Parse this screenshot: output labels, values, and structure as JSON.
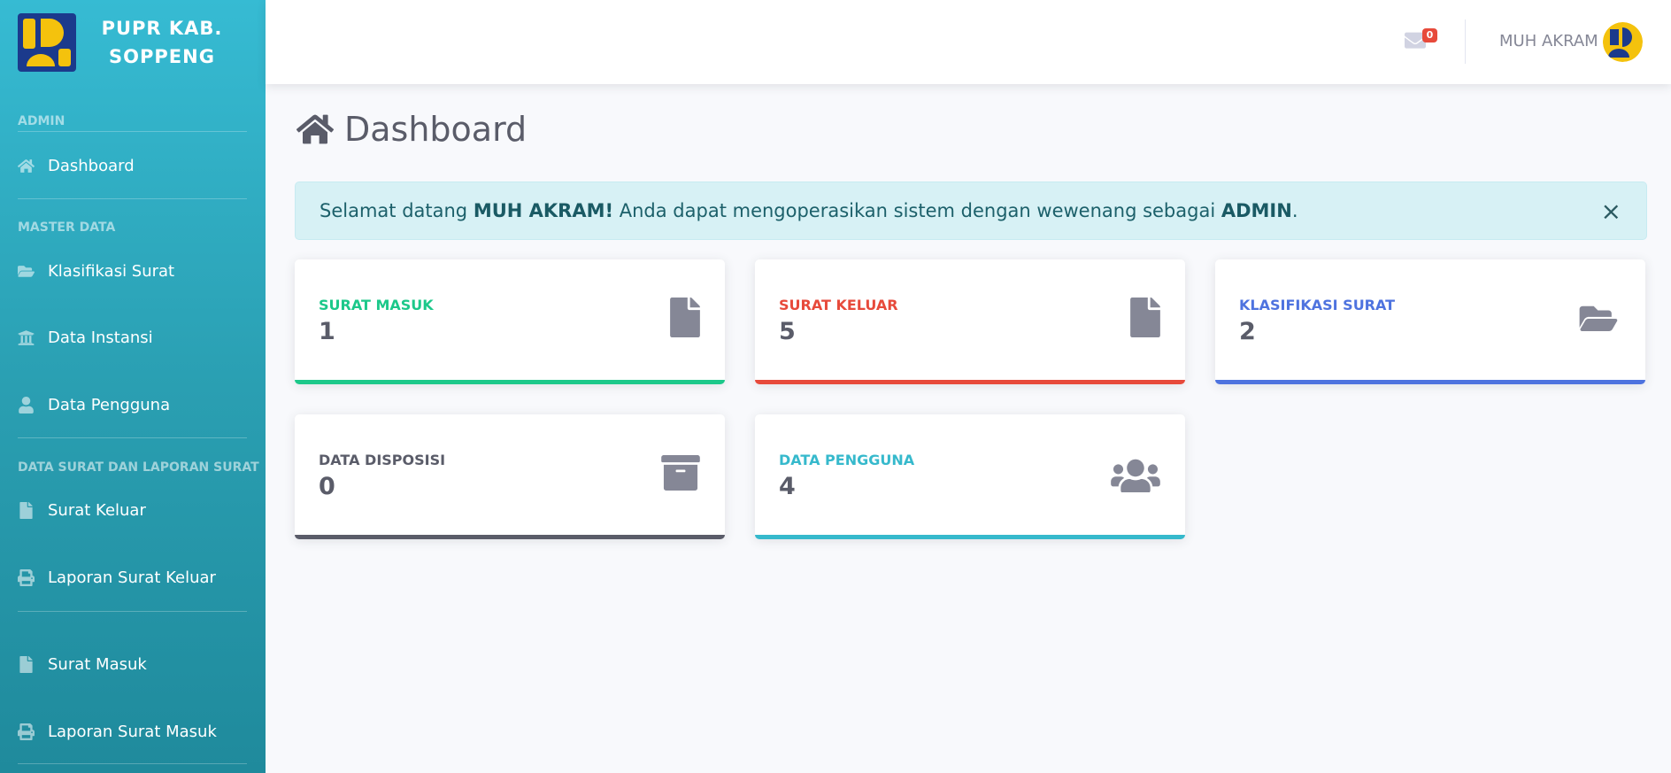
{
  "brand": {
    "line1": "PUPR KAB.",
    "line2": "SOPPENG"
  },
  "sidebar": {
    "sections": [
      "ADMIN",
      "MASTER DATA",
      "DATA SURAT DAN LAPORAN SURAT"
    ],
    "items": [
      {
        "label": "Dashboard",
        "icon": "home-icon"
      },
      {
        "label": "Klasifikasi Surat",
        "icon": "folder-open-icon"
      },
      {
        "label": "Data Instansi",
        "icon": "institution-icon"
      },
      {
        "label": "Data Pengguna",
        "icon": "user-icon"
      },
      {
        "label": "Surat Keluar",
        "icon": "file-icon"
      },
      {
        "label": "Laporan Surat Keluar",
        "icon": "print-icon"
      },
      {
        "label": "Surat Masuk",
        "icon": "file-icon"
      },
      {
        "label": "Laporan Surat Masuk",
        "icon": "print-icon"
      }
    ]
  },
  "topbar": {
    "mail_count": "0",
    "user_name": "MUH AKRAM"
  },
  "page": {
    "title": "Dashboard"
  },
  "alert": {
    "prefix": "Selamat datang ",
    "user": "MUH AKRAM!",
    "middle": " Anda dapat mengoperasikan sistem dengan wewenang sebagai ",
    "role": "ADMIN",
    "suffix": ".",
    "close": "×"
  },
  "cards": [
    {
      "label": "SURAT MASUK",
      "value": "1",
      "color": "#1cc88a",
      "icon": "file-icon"
    },
    {
      "label": "SURAT KELUAR",
      "value": "5",
      "color": "#e74a3b",
      "icon": "file-icon"
    },
    {
      "label": "KLASIFIKASI SURAT",
      "value": "2",
      "color": "#4e73df",
      "icon": "folder-open-icon"
    },
    {
      "label": "DATA DISPOSISI",
      "value": "0",
      "color": "#5a5c69",
      "icon": "archive-icon"
    },
    {
      "label": "DATA PENGGUNA",
      "value": "4",
      "color": "#36b9cc",
      "icon": "users-icon"
    }
  ]
}
